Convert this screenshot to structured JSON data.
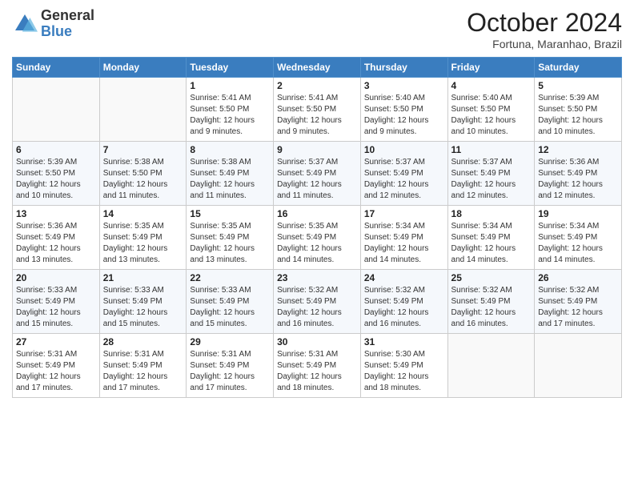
{
  "logo": {
    "general": "General",
    "blue": "Blue"
  },
  "header": {
    "title": "October 2024",
    "subtitle": "Fortuna, Maranhao, Brazil"
  },
  "weekdays": [
    "Sunday",
    "Monday",
    "Tuesday",
    "Wednesday",
    "Thursday",
    "Friday",
    "Saturday"
  ],
  "weeks": [
    [
      {
        "day": "",
        "sunrise": "",
        "sunset": "",
        "daylight": ""
      },
      {
        "day": "",
        "sunrise": "",
        "sunset": "",
        "daylight": ""
      },
      {
        "day": "1",
        "sunrise": "Sunrise: 5:41 AM",
        "sunset": "Sunset: 5:50 PM",
        "daylight": "Daylight: 12 hours and 9 minutes."
      },
      {
        "day": "2",
        "sunrise": "Sunrise: 5:41 AM",
        "sunset": "Sunset: 5:50 PM",
        "daylight": "Daylight: 12 hours and 9 minutes."
      },
      {
        "day": "3",
        "sunrise": "Sunrise: 5:40 AM",
        "sunset": "Sunset: 5:50 PM",
        "daylight": "Daylight: 12 hours and 9 minutes."
      },
      {
        "day": "4",
        "sunrise": "Sunrise: 5:40 AM",
        "sunset": "Sunset: 5:50 PM",
        "daylight": "Daylight: 12 hours and 10 minutes."
      },
      {
        "day": "5",
        "sunrise": "Sunrise: 5:39 AM",
        "sunset": "Sunset: 5:50 PM",
        "daylight": "Daylight: 12 hours and 10 minutes."
      }
    ],
    [
      {
        "day": "6",
        "sunrise": "Sunrise: 5:39 AM",
        "sunset": "Sunset: 5:50 PM",
        "daylight": "Daylight: 12 hours and 10 minutes."
      },
      {
        "day": "7",
        "sunrise": "Sunrise: 5:38 AM",
        "sunset": "Sunset: 5:50 PM",
        "daylight": "Daylight: 12 hours and 11 minutes."
      },
      {
        "day": "8",
        "sunrise": "Sunrise: 5:38 AM",
        "sunset": "Sunset: 5:49 PM",
        "daylight": "Daylight: 12 hours and 11 minutes."
      },
      {
        "day": "9",
        "sunrise": "Sunrise: 5:37 AM",
        "sunset": "Sunset: 5:49 PM",
        "daylight": "Daylight: 12 hours and 11 minutes."
      },
      {
        "day": "10",
        "sunrise": "Sunrise: 5:37 AM",
        "sunset": "Sunset: 5:49 PM",
        "daylight": "Daylight: 12 hours and 12 minutes."
      },
      {
        "day": "11",
        "sunrise": "Sunrise: 5:37 AM",
        "sunset": "Sunset: 5:49 PM",
        "daylight": "Daylight: 12 hours and 12 minutes."
      },
      {
        "day": "12",
        "sunrise": "Sunrise: 5:36 AM",
        "sunset": "Sunset: 5:49 PM",
        "daylight": "Daylight: 12 hours and 12 minutes."
      }
    ],
    [
      {
        "day": "13",
        "sunrise": "Sunrise: 5:36 AM",
        "sunset": "Sunset: 5:49 PM",
        "daylight": "Daylight: 12 hours and 13 minutes."
      },
      {
        "day": "14",
        "sunrise": "Sunrise: 5:35 AM",
        "sunset": "Sunset: 5:49 PM",
        "daylight": "Daylight: 12 hours and 13 minutes."
      },
      {
        "day": "15",
        "sunrise": "Sunrise: 5:35 AM",
        "sunset": "Sunset: 5:49 PM",
        "daylight": "Daylight: 12 hours and 13 minutes."
      },
      {
        "day": "16",
        "sunrise": "Sunrise: 5:35 AM",
        "sunset": "Sunset: 5:49 PM",
        "daylight": "Daylight: 12 hours and 14 minutes."
      },
      {
        "day": "17",
        "sunrise": "Sunrise: 5:34 AM",
        "sunset": "Sunset: 5:49 PM",
        "daylight": "Daylight: 12 hours and 14 minutes."
      },
      {
        "day": "18",
        "sunrise": "Sunrise: 5:34 AM",
        "sunset": "Sunset: 5:49 PM",
        "daylight": "Daylight: 12 hours and 14 minutes."
      },
      {
        "day": "19",
        "sunrise": "Sunrise: 5:34 AM",
        "sunset": "Sunset: 5:49 PM",
        "daylight": "Daylight: 12 hours and 14 minutes."
      }
    ],
    [
      {
        "day": "20",
        "sunrise": "Sunrise: 5:33 AM",
        "sunset": "Sunset: 5:49 PM",
        "daylight": "Daylight: 12 hours and 15 minutes."
      },
      {
        "day": "21",
        "sunrise": "Sunrise: 5:33 AM",
        "sunset": "Sunset: 5:49 PM",
        "daylight": "Daylight: 12 hours and 15 minutes."
      },
      {
        "day": "22",
        "sunrise": "Sunrise: 5:33 AM",
        "sunset": "Sunset: 5:49 PM",
        "daylight": "Daylight: 12 hours and 15 minutes."
      },
      {
        "day": "23",
        "sunrise": "Sunrise: 5:32 AM",
        "sunset": "Sunset: 5:49 PM",
        "daylight": "Daylight: 12 hours and 16 minutes."
      },
      {
        "day": "24",
        "sunrise": "Sunrise: 5:32 AM",
        "sunset": "Sunset: 5:49 PM",
        "daylight": "Daylight: 12 hours and 16 minutes."
      },
      {
        "day": "25",
        "sunrise": "Sunrise: 5:32 AM",
        "sunset": "Sunset: 5:49 PM",
        "daylight": "Daylight: 12 hours and 16 minutes."
      },
      {
        "day": "26",
        "sunrise": "Sunrise: 5:32 AM",
        "sunset": "Sunset: 5:49 PM",
        "daylight": "Daylight: 12 hours and 17 minutes."
      }
    ],
    [
      {
        "day": "27",
        "sunrise": "Sunrise: 5:31 AM",
        "sunset": "Sunset: 5:49 PM",
        "daylight": "Daylight: 12 hours and 17 minutes."
      },
      {
        "day": "28",
        "sunrise": "Sunrise: 5:31 AM",
        "sunset": "Sunset: 5:49 PM",
        "daylight": "Daylight: 12 hours and 17 minutes."
      },
      {
        "day": "29",
        "sunrise": "Sunrise: 5:31 AM",
        "sunset": "Sunset: 5:49 PM",
        "daylight": "Daylight: 12 hours and 17 minutes."
      },
      {
        "day": "30",
        "sunrise": "Sunrise: 5:31 AM",
        "sunset": "Sunset: 5:49 PM",
        "daylight": "Daylight: 12 hours and 18 minutes."
      },
      {
        "day": "31",
        "sunrise": "Sunrise: 5:30 AM",
        "sunset": "Sunset: 5:49 PM",
        "daylight": "Daylight: 12 hours and 18 minutes."
      },
      {
        "day": "",
        "sunrise": "",
        "sunset": "",
        "daylight": ""
      },
      {
        "day": "",
        "sunrise": "",
        "sunset": "",
        "daylight": ""
      }
    ]
  ]
}
